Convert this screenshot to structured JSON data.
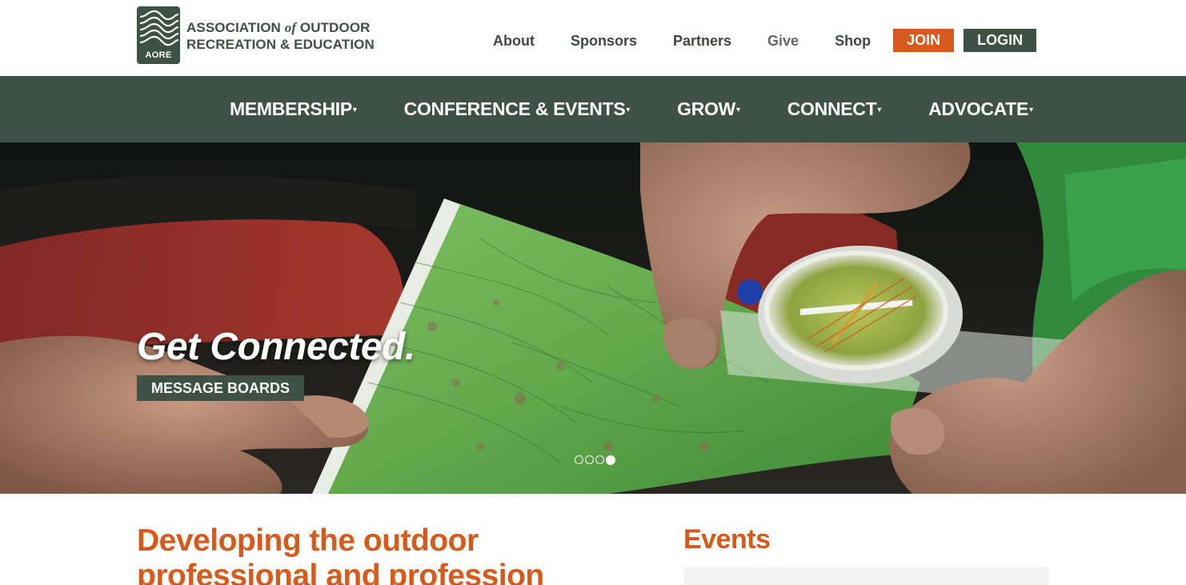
{
  "logo": {
    "abbr": "AORE",
    "line1_a": "ASSOCIATION ",
    "line1_of": "of",
    "line1_b": " OUTDOOR",
    "line2": "RECREATION & EDUCATION"
  },
  "utility_nav": {
    "about": "About",
    "sponsors": "Sponsors",
    "partners": "Partners",
    "give": "Give",
    "shop": "Shop",
    "join": "JOIN",
    "login": "LOGIN"
  },
  "main_nav": {
    "items": [
      {
        "label": "MEMBERSHIP",
        "caret": "▾"
      },
      {
        "label": "CONFERENCE & EVENTS",
        "caret": "▾"
      },
      {
        "label": "GROW",
        "caret": "▾"
      },
      {
        "label": "CONNECT",
        "caret": "▾"
      },
      {
        "label": "ADVOCATE",
        "caret": "▾"
      }
    ]
  },
  "hero": {
    "title": "Get Connected.",
    "button": "MESSAGE BOARDS",
    "slides_total": 4,
    "active_slide": 4
  },
  "main": {
    "heading": "Developing the outdoor professional and profession"
  },
  "events": {
    "heading": "Events"
  },
  "colors": {
    "accent_orange": "#d85a1a",
    "brand_green": "#3f5047"
  }
}
